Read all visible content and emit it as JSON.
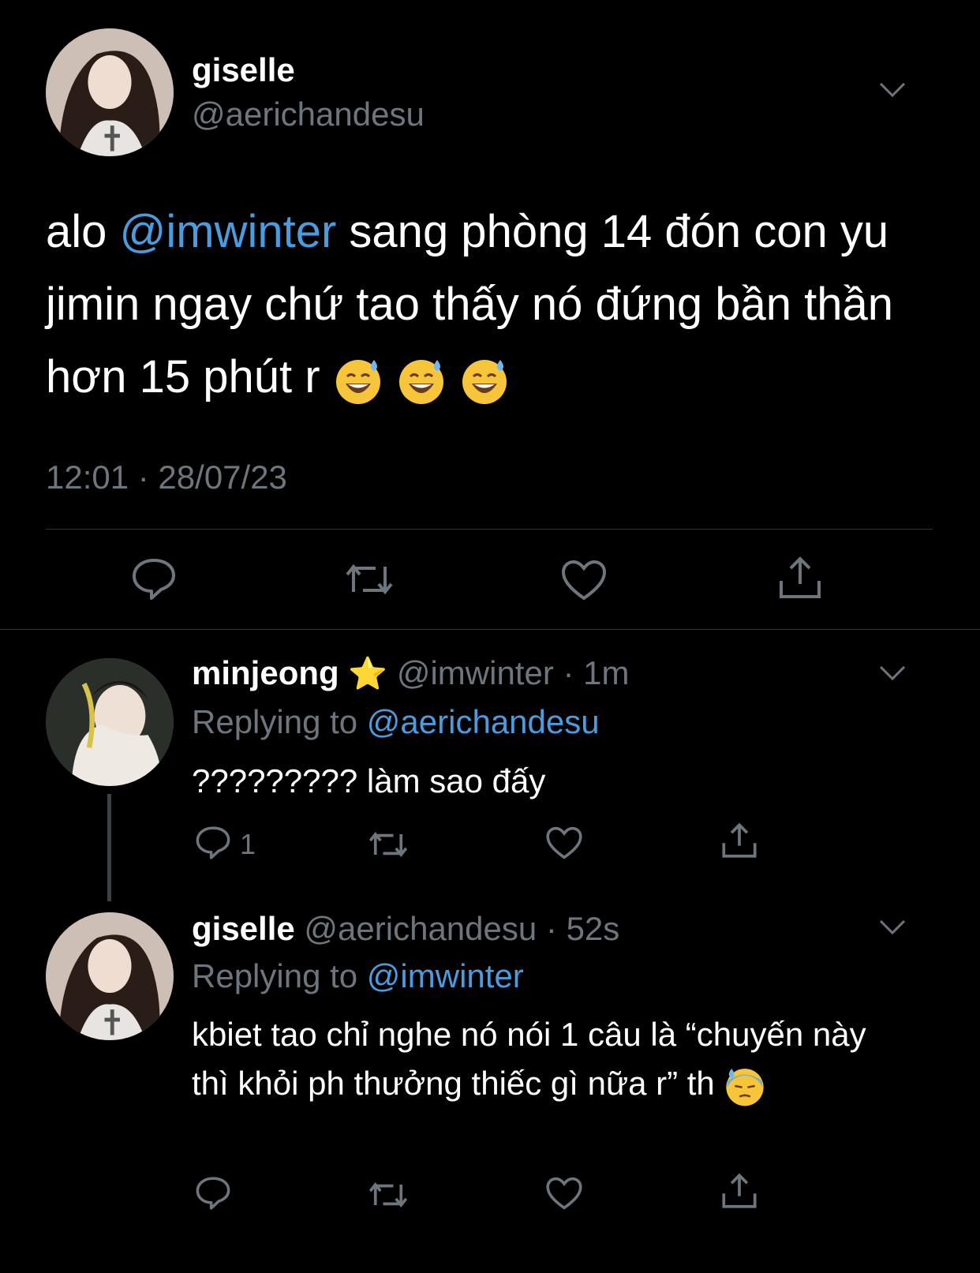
{
  "main_tweet": {
    "name": "giselle",
    "handle": "@aerichandesu",
    "text_before": "alo ",
    "mention": "@imwinter",
    "text_after": " sang phòng 14 đón con yu jimin ngay chứ tao thấy nó đứng bần thần hơn 15 phút r",
    "emojis": [
      "😅",
      "😅",
      "😅"
    ],
    "timestamp": "12:01 · 28/07/23",
    "actions": [
      "reply-icon",
      "retweet-icon",
      "like-icon",
      "share-icon"
    ]
  },
  "reply1": {
    "name": "minjeong",
    "badge": "⭐",
    "handle_time": "@imwinter · 1m",
    "replying_label": "Replying to",
    "replying_to": "@aerichandesu",
    "text": "????????? làm sao đấy",
    "reply_count": "1"
  },
  "reply2": {
    "name": "giselle",
    "handle_time": "@aerichandesu · 52s",
    "replying_label": "Replying to",
    "replying_to": "@imwinter",
    "text": "kbiet tao chỉ nghe nó nói 1 câu là “chuyến này thì khỏi ph thưởng thiếc gì nữa r” th",
    "emoji": "😓"
  },
  "colors": {
    "background": "#000000",
    "link": "#4b9bdf",
    "muted": "#6e767d",
    "divider": "#2f3336"
  }
}
